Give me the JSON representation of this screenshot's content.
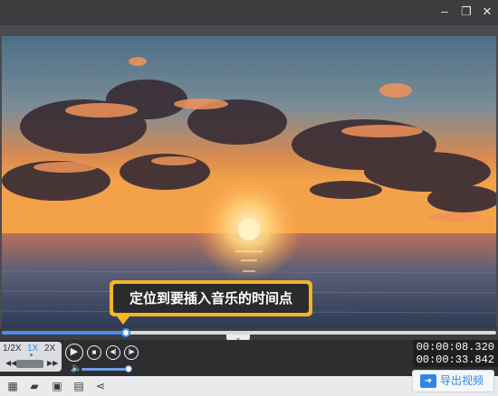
{
  "window": {
    "minimize_glyph": "–",
    "restore_glyph": "❐",
    "close_glyph": "✕"
  },
  "video": {
    "description_icon": "sunset-video-frame"
  },
  "tooltip": {
    "text": "定位到要插入音乐的时间点"
  },
  "timeline": {
    "progress_fraction": 0.25,
    "collapse_glyph": "⌄"
  },
  "speed": {
    "options": [
      "1/2X",
      "1X",
      "2X"
    ],
    "selected": "1X"
  },
  "player": {
    "play_icon": "play-icon",
    "stop_icon": "stop-icon",
    "prev_frame_icon": "previous-frame-icon",
    "next_frame_icon": "next-frame-icon",
    "volume_fraction": 0.92
  },
  "time": {
    "current": "00:00:08.320",
    "total": "00:00:33.842"
  },
  "toolbar": {
    "tools": [
      "subtitle-icon",
      "open-folder-icon",
      "save-icon",
      "save-as-icon",
      "share-icon"
    ],
    "export_label": "导出视频"
  },
  "colors": {
    "accent": "#2f86e6",
    "tooltip_border": "#f4b521"
  }
}
